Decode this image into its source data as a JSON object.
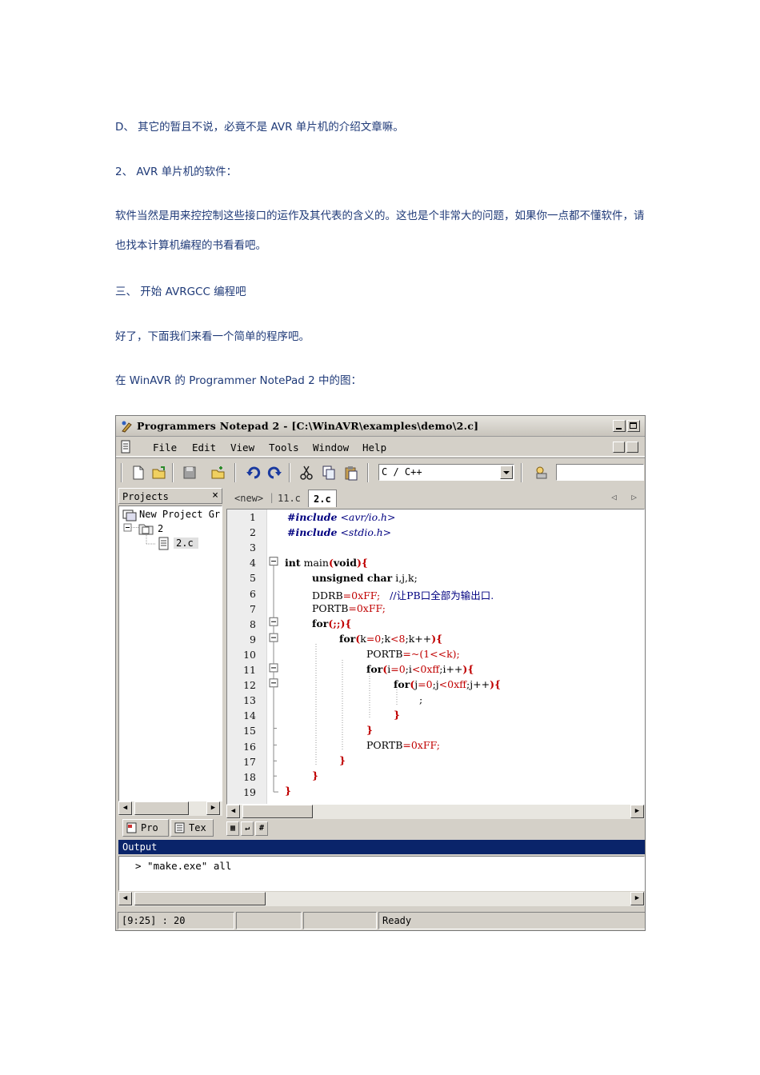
{
  "paragraphs": {
    "p1": "D、 其它的暂且不说，必竟不是 AVR 单片机的介绍文章嘛。",
    "p2": "2、 AVR 单片机的软件：",
    "p3": "软件当然是用来控控制这些接口的运作及其代表的含义的。这也是个非常大的问题，如果你一点都不懂软件，请也找本计算机编程的书看看吧。",
    "p4": "三、 开始 AVRGCC 编程吧",
    "p5": "好了，下面我们来看一个简单的程序吧。",
    "p6": "在 WinAVR 的 Programmer NotePad 2 中的图："
  },
  "window": {
    "title": "Programmers Notepad 2 - [C:\\WinAVR\\examples\\demo\\2.c]",
    "menu": [
      "File",
      "Edit",
      "View",
      "Tools",
      "Window",
      "Help"
    ],
    "language": "C / C++",
    "find_value": ""
  },
  "projects": {
    "header": "Projects",
    "close": "×",
    "tree": {
      "root": "New Project Gr",
      "project": "2",
      "file": "2.c"
    },
    "bottom_tabs": [
      "Pro",
      "Tex"
    ]
  },
  "editor": {
    "tabs": [
      "<new>",
      "11.c",
      "2.c"
    ],
    "active_tab": 2,
    "nav": "◁ ▷",
    "line_numbers": [
      "1",
      "2",
      "3",
      "4",
      "5",
      "6",
      "7",
      "8",
      "9",
      "10",
      "11",
      "12",
      "13",
      "14",
      "15",
      "16",
      "17",
      "18",
      "19"
    ],
    "tool_glyphs": [
      "▦",
      "↵",
      "#"
    ]
  },
  "output": {
    "title": "Output",
    "text": "> \"make.exe\" all"
  },
  "status": {
    "position": "[9:25] : 20",
    "panel2": "",
    "panel3": "",
    "message": "Ready"
  },
  "colors": {
    "paragraph_text": "#1f3a78",
    "keyword": "#000080",
    "number": "#c00000",
    "output_title_bg": "#0a246a"
  }
}
